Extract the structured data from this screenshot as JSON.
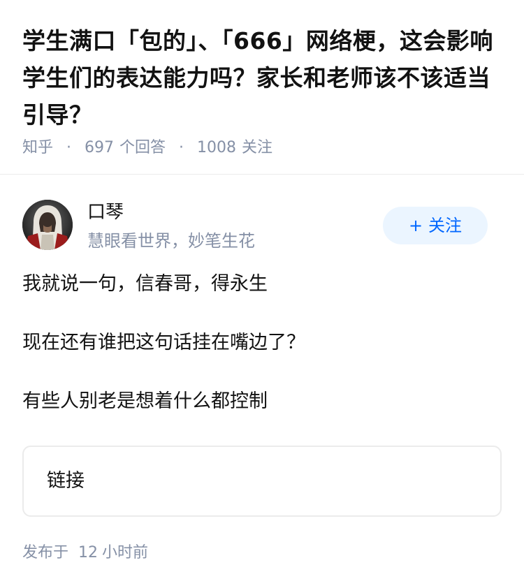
{
  "question": {
    "title": "学生满口「包的」、「666」网络梗，这会影响学生们的表达能力吗？家长和老师该不该适当引导？",
    "meta": {
      "source": "知乎",
      "answer_count": "697",
      "answer_label": "个回答",
      "follower_count": "1008",
      "follower_label": "关注",
      "separator": "·"
    }
  },
  "answer": {
    "author": {
      "name": "口琴",
      "headline": "慧眼看世界，妙笔生花",
      "avatar_icon": "hooded-figure-avatar"
    },
    "follow_button": {
      "icon": "+",
      "label": "关注"
    },
    "paragraphs": [
      "我就说一句，信春哥，得永生",
      "现在还有谁把这句话挂在嘴边了？",
      "有些人别老是想着什么都控制"
    ],
    "link_card": {
      "label": "链接"
    },
    "publish": {
      "prefix": "发布于",
      "value": "12",
      "unit": "小时前"
    }
  },
  "colors": {
    "text_primary": "#121212",
    "text_secondary": "#8590a6",
    "brand_blue": "#0066ff",
    "follow_bg": "#ebf5ff",
    "divider": "#ebebeb"
  }
}
